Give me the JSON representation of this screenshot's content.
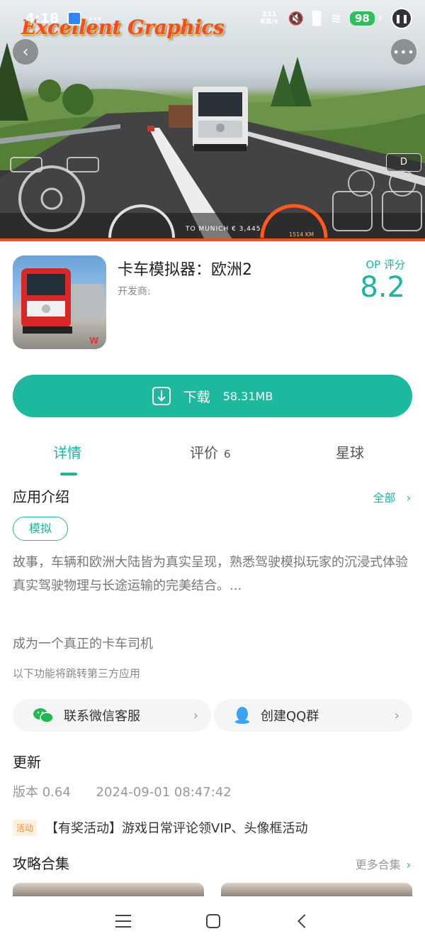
{
  "status_bar": {
    "time": "4:18",
    "net_speed_value": "231",
    "net_speed_unit": "KB/s",
    "battery": "98"
  },
  "hero": {
    "title": "Excellent Graphics",
    "hud_gear": "D",
    "hud_destination": "TO MUNICH € 3,445",
    "hud_distance": "1514 KM"
  },
  "app": {
    "name": "卡车模拟器：欧洲2",
    "developer_label": "开发商:",
    "score_label": "OP 评分",
    "score": "8.2",
    "icon_badge": "W"
  },
  "download": {
    "label": "下载",
    "size": "58.31MB"
  },
  "tabs": [
    {
      "label": "详情",
      "count": ""
    },
    {
      "label": "评价",
      "count": "6"
    },
    {
      "label": "星球",
      "count": ""
    }
  ],
  "intro": {
    "title": "应用介绍",
    "all_link": "全部",
    "tag": "模拟",
    "description": "故事，车辆和欧洲大陆皆为真实呈现，熟悉驾驶模拟玩家的沉浸式体验\n真实驾驶物理与长途运输的完美结合。...",
    "slogan": "成为一个真正的卡车司机",
    "third_party_note": "以下功能将跳转第三方应用"
  },
  "contacts": [
    {
      "label": "联系微信客服",
      "icon": "wechat-icon"
    },
    {
      "label": "创建QQ群",
      "icon": "qq-icon"
    }
  ],
  "update": {
    "title": "更新",
    "version": "版本 0.64",
    "date": "2024-09-01 08:47:42"
  },
  "promo": {
    "tag": "活动",
    "text": "【有奖活动】游戏日常评论领VIP、头像框活动"
  },
  "guides": {
    "title": "攻略合集",
    "more_link": "更多合集"
  },
  "colors": {
    "accent": "#1db99e",
    "promo_orange": "#ff8a1c"
  }
}
